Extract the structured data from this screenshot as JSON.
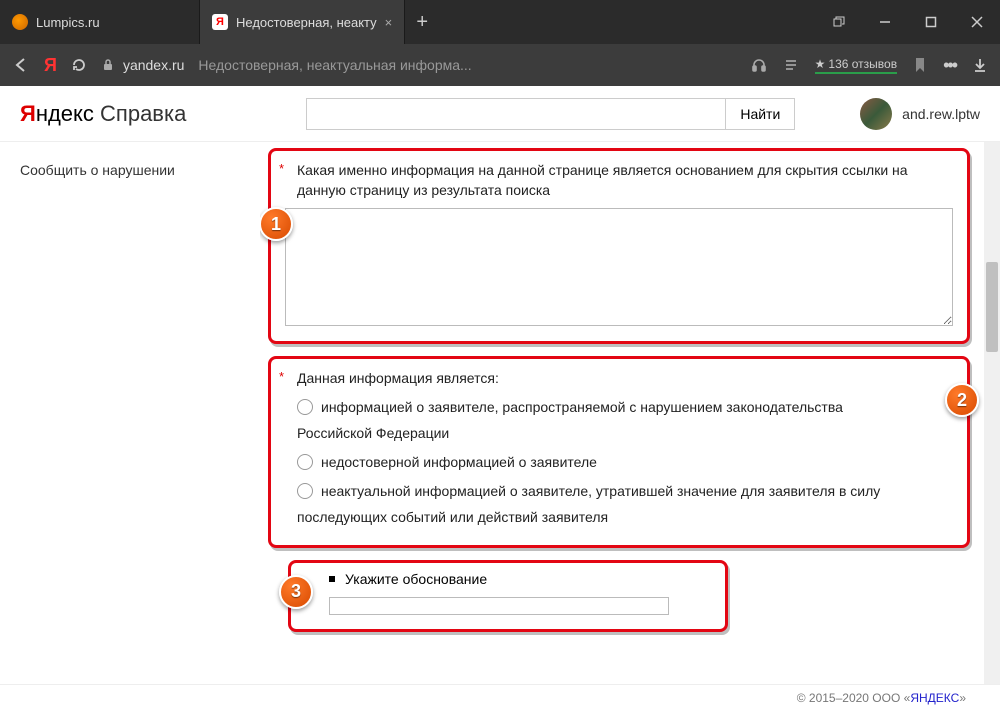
{
  "browser": {
    "tabs": [
      {
        "label": "Lumpics.ru"
      },
      {
        "label": "Недостоверная, неакту"
      }
    ],
    "url_domain": "yandex.ru",
    "url_title": "Недостоверная, неактуальная информа...",
    "reviews": "136 отзывов"
  },
  "header": {
    "logo_red": "Я",
    "logo_rest": "ндекс",
    "logo_section": "Справка",
    "search_button": "Найти",
    "username": "and.rew.lptw"
  },
  "sidebar": {
    "item": "Сообщить о нарушении"
  },
  "form": {
    "section1_label": "Какая именно информация на данной странице является основанием для скрытия ссылки на данную страницу из результата поиска",
    "section2_label": "Данная информация является:",
    "radio1": "информацией о заявителе, распространяемой с нарушением законодательства",
    "radio1_cont": "Российской Федерации",
    "radio2": "недостоверной информацией о заявителе",
    "radio3": "неактуальной информацией о заявителе, утратившей значение для заявителя в силу",
    "radio3_cont": "последующих событий или действий заявителя",
    "section3_label": "Укажите обоснование"
  },
  "badges": {
    "n1": "1",
    "n2": "2",
    "n3": "3"
  },
  "footer": {
    "copyright": "© 2015–2020  ООО «",
    "link": "ЯНДЕКС",
    "tail": "»"
  }
}
